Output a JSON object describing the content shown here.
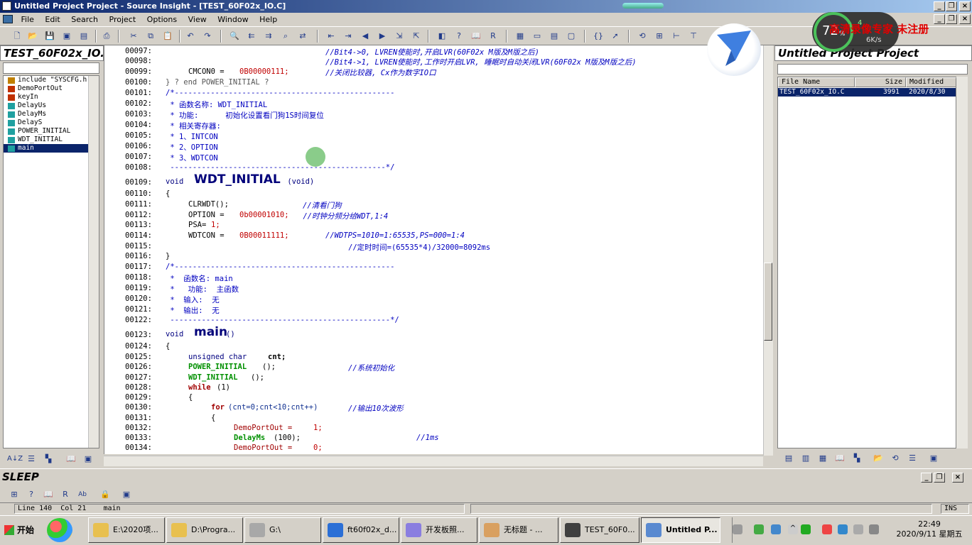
{
  "window": {
    "title": "Untitled Project Project - Source Insight - [TEST_60F02x_IO.C]"
  },
  "menu": [
    "File",
    "Edit",
    "Search",
    "Project",
    "Options",
    "View",
    "Window",
    "Help"
  ],
  "symbol_panel": {
    "title": "TEST_60F02x_IO.C",
    "items": [
      {
        "label": "include \"SYSCFG.h",
        "icon": "hash-icon"
      },
      {
        "label": "DemoPortOut",
        "icon": "hash-icon"
      },
      {
        "label": "keyIn",
        "icon": "hash-icon"
      },
      {
        "label": "DelayUs",
        "icon": "function-icon"
      },
      {
        "label": "DelayMs",
        "icon": "function-icon"
      },
      {
        "label": "DelayS",
        "icon": "function-icon"
      },
      {
        "label": "POWER_INITIAL",
        "icon": "function-icon"
      },
      {
        "label": "WDT_INITIAL",
        "icon": "function-icon"
      },
      {
        "label": "main",
        "icon": "function-icon",
        "selected": true
      }
    ]
  },
  "editor": {
    "lines": [
      {
        "n": "00097:",
        "code": "                      //Bit4->0, LVREN使能时,开启LVR(60F02x M版及M版之后)"
      },
      {
        "n": "00098:",
        "code": "                      //Bit4->1, LVREN使能时,工作时开启LVR, 睡眠时自动关闭LVR(60F02x M版及M版之后)"
      },
      {
        "n": "00099:",
        "code": "    CMCON0 = 0B00000111;    //关闭比较器, Cx作为数字IO口"
      },
      {
        "n": "00100:",
        "code": "} ? end POWER_INITIAL ?"
      },
      {
        "n": "00101:",
        "code": "/*-------------------------------------------------"
      },
      {
        "n": "00102:",
        "code": " * 函数名称: WDT_INITIAL"
      },
      {
        "n": "00103:",
        "code": " * 功能:      初始化设置看门狗1S时间复位"
      },
      {
        "n": "00104:",
        "code": " * 相关寄存器:"
      },
      {
        "n": "00105:",
        "code": " * 1、INTCON"
      },
      {
        "n": "00106:",
        "code": " * 2、OPTION"
      },
      {
        "n": "00107:",
        "code": " * 3、WDTCON"
      },
      {
        "n": "00108:",
        "code": " ------------------------------------------------*/"
      },
      {
        "n": "00109:",
        "code": "void WDT_INITIAL (void)"
      },
      {
        "n": "00110:",
        "code": "{"
      },
      {
        "n": "00111:",
        "code": "    CLRWDT();              //清看门狗"
      },
      {
        "n": "00112:",
        "code": "    OPTION = 0b00001010; //时钟分频分给WDT,1:4"
      },
      {
        "n": "00113:",
        "code": "    PSA=1;"
      },
      {
        "n": "00114:",
        "code": "    WDTCON = 0B00011111;    //WDTPS=1010=1:65535,PS=000=1:4"
      },
      {
        "n": "00115:",
        "code": "                                //定时时间=(65535*4)/32000=8092ms"
      },
      {
        "n": "00116:",
        "code": "}"
      },
      {
        "n": "00117:",
        "code": "/*-------------------------------------------------"
      },
      {
        "n": "00118:",
        "code": " *  函数名: main"
      },
      {
        "n": "00119:",
        "code": " *   功能:  主函数"
      },
      {
        "n": "00120:",
        "code": " *  输入:  无"
      },
      {
        "n": "00121:",
        "code": " *  输出:  无"
      },
      {
        "n": "00122:",
        "code": " -------------------------------------------------*/"
      },
      {
        "n": "00123:",
        "code": "void main()"
      },
      {
        "n": "00124:",
        "code": "{"
      },
      {
        "n": "00125:",
        "code": "    unsigned char cnt;"
      },
      {
        "n": "00126:",
        "code": "    POWER_INITIAL();             //系统初始化"
      },
      {
        "n": "00127:",
        "code": "    WDT_INITIAL();"
      },
      {
        "n": "00128:",
        "code": "    while(1)"
      },
      {
        "n": "00129:",
        "code": "    {"
      },
      {
        "n": "00130:",
        "code": "        for(cnt=0;cnt<10;cnt++)  //输出10次波形"
      },
      {
        "n": "00131:",
        "code": "        {"
      },
      {
        "n": "00132:",
        "code": "            DemoPortOut = 1;"
      },
      {
        "n": "00133:",
        "code": "            DelayMs(100);                    //1ms"
      },
      {
        "n": "00134:",
        "code": "            DemoPortOut = 0;"
      }
    ],
    "fragments": {
      "l97": "//Bit4->0, LVREN使能时,开启LVR(60F02x M版及M版之后)",
      "l98": "//Bit4->1, LVREN使能时,工作时开启LVR, 睡眠时自动关闭LVR(60F02x M版及M版之后)",
      "l99a": "CMCON0 = ",
      "l99b": "0B00000111;",
      "l99c": "//关闭比较器, Cx作为数字IO口",
      "l100": "} ? end POWER_INITIAL ?",
      "l101": "/*-------------------------------------------------",
      "l102": " * 函数名称: WDT_INITIAL",
      "l103": " * 功能:      初始化设置看门狗1S时间复位",
      "l104": " * 相关寄存器:",
      "l105": " * 1、INTCON",
      "l106": " * 2、OPTION",
      "l107": " * 3、WDTCON",
      "l108": " ------------------------------------------------*/",
      "l109a": "void ",
      "l109b": "WDT_INITIAL",
      "l109c": " (void)",
      "l110": "{",
      "l111a": "CLRWDT();",
      "l111b": "//清看门狗",
      "l112a": "OPTION = ",
      "l112b": "0b00001010;",
      "l112c": " //时钟分频分给WDT,1:4",
      "l113a": "PSA=",
      "l113b": "1;",
      "l114a": "WDTCON = ",
      "l114b": "0B00011111;",
      "l114c": "//WDTPS=1010=1:65535,PS=000=1:4",
      "l115": "//定时时间=(65535*4)/32000=8092ms",
      "l116": "}",
      "l117": "/*-------------------------------------------------",
      "l118": " *  函数名: main",
      "l119": " *   功能:  主函数",
      "l120": " *  输入:  无",
      "l121": " *  输出:  无",
      "l122": " -------------------------------------------------*/",
      "l123a": "void ",
      "l123b": "main",
      "l123c": "()",
      "l124": "{",
      "l125a": "unsigned char ",
      "l125b": "cnt;",
      "l126a": "POWER_INITIAL",
      "l126b": "();",
      "l126c": "//系统初始化",
      "l127a": "WDT_INITIAL",
      "l127b": "();",
      "l128a": "while",
      "l128b": "(1)",
      "l129": "{",
      "l130a": "for",
      "l130b": "(cnt=0;cnt<10;cnt++)",
      "l130c": "//输出10次波形",
      "l131": "{",
      "l132a": "DemoPortOut = ",
      "l132b": "1;",
      "l133a": "DelayMs",
      "l133b": "(100);",
      "l133c": "//1ms",
      "l134a": "DemoPortOut = ",
      "l134b": "0;"
    }
  },
  "project_panel": {
    "title": "Untitled Project Project",
    "columns": {
      "file": "File Name",
      "size": "Size",
      "modified": "Modified"
    },
    "row": {
      "file": "TEST_60F02x_IO.C",
      "size": "3991",
      "modified": "2020/8/30"
    }
  },
  "context_panel": {
    "title": "SLEEP"
  },
  "status": {
    "line": "Line 140",
    "col": "Col 21",
    "func": "main",
    "mode": "INS"
  },
  "overlays": {
    "meter_percent": "72",
    "meter_unit": "%",
    "rate_up": "4",
    "rate_down": "6K/s",
    "promo": "高清录像专家 未注册"
  },
  "taskbar": {
    "start": "开始",
    "tasks": [
      {
        "label": "E:\\2020项...",
        "icon": "folder-icon"
      },
      {
        "label": "D:\\Progra...",
        "icon": "folder-icon"
      },
      {
        "label": "G:\\",
        "icon": "drive-icon"
      },
      {
        "label": "ft60f02x_d...",
        "icon": "doc-icon"
      },
      {
        "label": "开发板照...",
        "icon": "image-icon"
      },
      {
        "label": "无标题 - ...",
        "icon": "paint-icon"
      },
      {
        "label": "TEST_60F0...",
        "icon": "chip-icon"
      },
      {
        "label": "Untitled P...",
        "icon": "source-insight-icon",
        "active": true
      }
    ],
    "clock": {
      "time": "22:49",
      "date": "2020/9/11 星期五"
    }
  },
  "colors": {
    "selection": "#0a246a",
    "title_start": "#0a246a",
    "comment": "#0000c0",
    "number": "#c00000",
    "keyword": "#009000"
  }
}
